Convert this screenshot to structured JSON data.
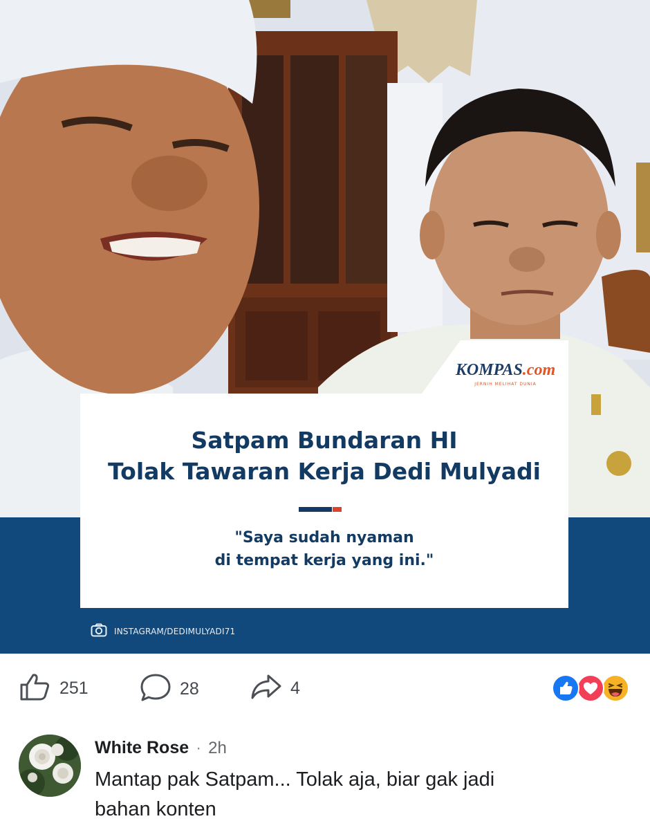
{
  "post": {
    "source_logo": {
      "wordmark": "KOMPAS",
      "domain": ".com",
      "tagline": "JERNIH MELIHAT DUNIA"
    },
    "headline_lines": [
      "Satpam Bundaran HI",
      "Tolak Tawaran Kerja Dedi Mulyadi"
    ],
    "quote_lines": [
      "\"Saya sudah nyaman",
      "di tempat kerja yang ini.\""
    ],
    "credit": "INSTAGRAM/DEDIMULYADI71",
    "credit_icon": "camera-icon",
    "colors": {
      "brand_navy": "#123a62",
      "band_blue": "#12497d",
      "accent_red": "#d9442b"
    }
  },
  "actions": {
    "like": {
      "icon": "thumbs-up-icon",
      "count": "251"
    },
    "comment": {
      "icon": "comment-bubble-icon",
      "count": "28"
    },
    "share": {
      "icon": "share-arrow-icon",
      "count": "4"
    },
    "reactions": [
      "like-reaction-icon",
      "love-reaction-icon",
      "haha-reaction-icon"
    ],
    "reaction_colors": {
      "like": "#1877f2",
      "love": "#f33e58",
      "haha": "#f7b125"
    }
  },
  "comment": {
    "author": "White Rose",
    "separator": "·",
    "time": "2h",
    "text_lines": [
      "Mantap pak Satpam... Tolak aja, biar gak jadi",
      "bahan konten"
    ],
    "avatar": "white-rose-flowers-avatar"
  }
}
